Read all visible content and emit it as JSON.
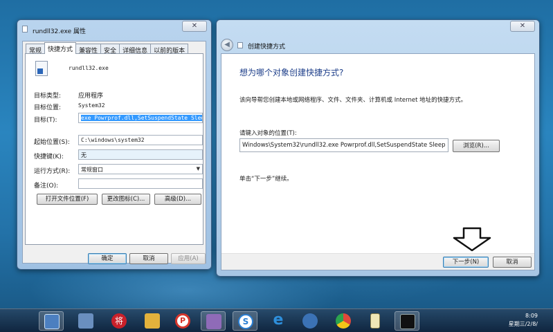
{
  "properties_window": {
    "title": "rundll32.exe 属性",
    "tabs": [
      "常规",
      "快捷方式",
      "兼容性",
      "安全",
      "详细信息",
      "以前的版本"
    ],
    "active_tab": "快捷方式",
    "file_name": "rundll32.exe",
    "target_type_label": "目标类型:",
    "target_type_value": "应用程序",
    "target_location_label": "目标位置:",
    "target_location_value": "System32",
    "target_label": "目标(T):",
    "target_value": "exe Powrprof.dll,SetSuspendState Sleep",
    "start_in_label": "起始位置(S):",
    "start_in_value": "C:\\windows\\system32",
    "shortcut_key_label": "快捷键(K):",
    "shortcut_key_value": "无",
    "run_label": "运行方式(R):",
    "run_value": "常规窗口",
    "comment_label": "备注(O):",
    "comment_value": "",
    "open_location_button": "打开文件位置(F)",
    "change_icon_button": "更改图标(C)...",
    "advanced_button": "高级(D)...",
    "ok_button": "确定",
    "cancel_button": "取消",
    "apply_button": "应用(A)",
    "close_glyph": "✕"
  },
  "wizard_window": {
    "title": "创建快捷方式",
    "heading": "想为哪个对象创建快捷方式?",
    "description": "该向导帮您创建本地或网络程序、文件、文件夹、计算机或 Internet 地址的快捷方式。",
    "location_label": "请键入对象的位置(T):",
    "location_value": "Windows\\System32\\rundll32.exe Powrprof.dll,SetSuspendState Sleep",
    "browse_button": "浏览(R)...",
    "hint": "单击“下一步”继续。",
    "next_button": "下一步(N)",
    "cancel_button": "取消",
    "close_glyph": "✕",
    "back_glyph": "◀"
  },
  "taskbar": {
    "items": [
      {
        "icon": "desktop-icon",
        "color": "#4c7fc0"
      },
      {
        "icon": "control-panel-icon",
        "color": "#6a8fbf"
      },
      {
        "icon": "chess-app-icon",
        "color": "#c8202a",
        "glyph": "将"
      },
      {
        "icon": "folder-icon",
        "color": "#e3b23c"
      },
      {
        "icon": "p-app-icon",
        "color": "#d6362c",
        "glyph": "P"
      },
      {
        "icon": "paint-icon",
        "color": "#8f6bb8"
      },
      {
        "icon": "sogou-icon",
        "color": "#2a7fd3",
        "glyph": "S"
      },
      {
        "icon": "ie-icon",
        "color": "#2e8fdc",
        "glyph": "e"
      },
      {
        "icon": "settings-icon",
        "color": "#3b72b5"
      },
      {
        "icon": "chrome-icon",
        "color": "#e0483a"
      },
      {
        "icon": "notepad-icon",
        "color": "#efe6b6"
      },
      {
        "icon": "cmd-icon",
        "color": "#111111"
      }
    ],
    "clock_time": "8:09",
    "clock_date": "星期三/2/8/"
  },
  "colors": {
    "accent": "#3399ff",
    "heading": "#1e3f8a",
    "close": "#c9462c"
  }
}
